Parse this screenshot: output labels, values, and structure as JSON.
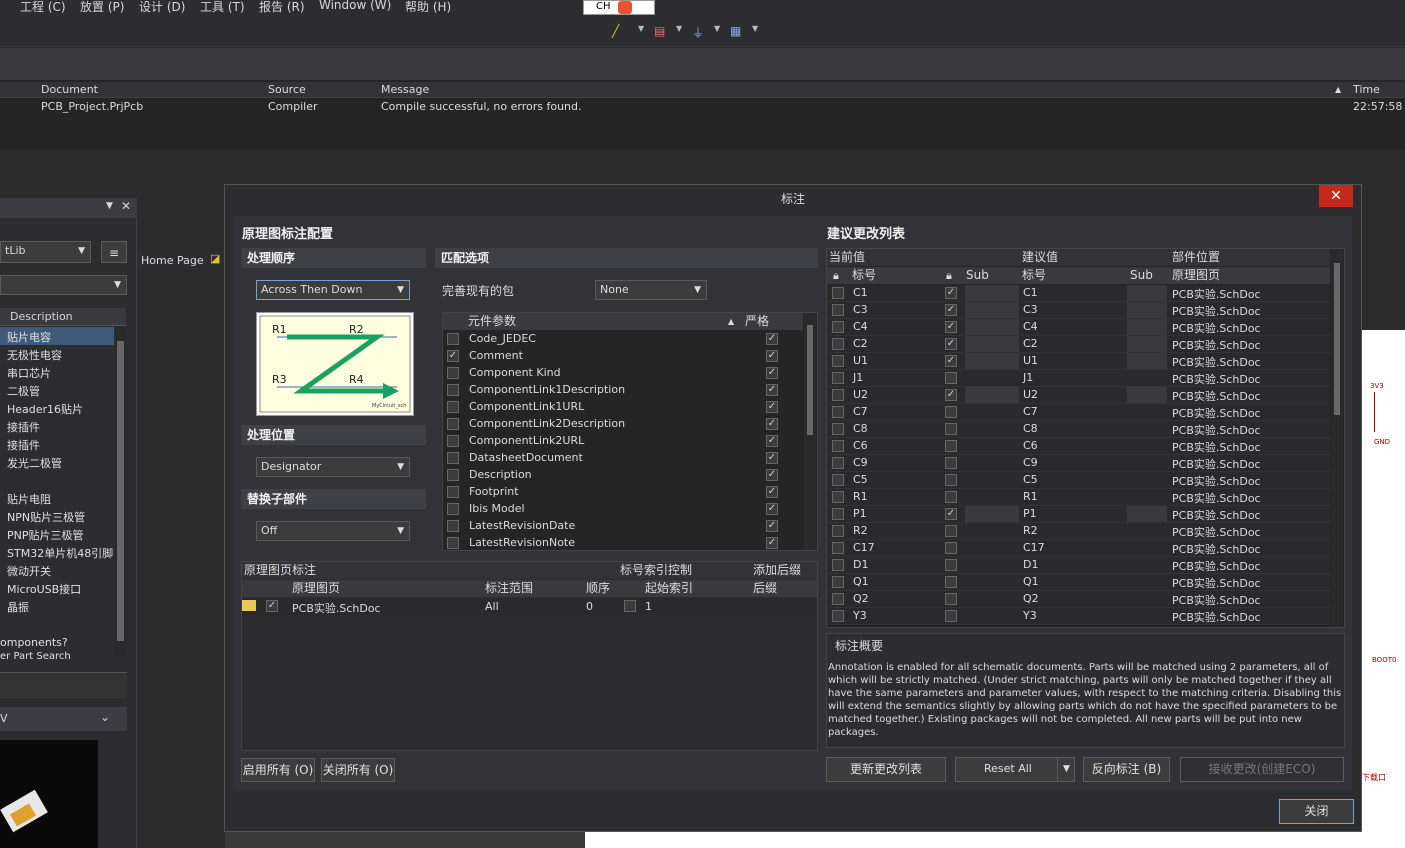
{
  "menu": [
    "工程 (C)",
    "放置 (P)",
    "设计 (D)",
    "工具 (T)",
    "报告 (R)",
    "Window (W)",
    "帮助 (H)"
  ],
  "ime_label": "CH",
  "messages": {
    "headers": {
      "document": "Document",
      "source": "Source",
      "message": "Message",
      "time": "Time"
    },
    "row": {
      "document": "PCB_Project.PrjPcb",
      "source": "Compiler",
      "message": "Compile successful, no errors found.",
      "time": "22:57:58"
    }
  },
  "left_panel": {
    "lib_combo": "tLib",
    "col_header": "Description",
    "items": [
      "贴片电容",
      "无极性电容",
      "串口芯片",
      "二极管",
      "Header16贴片",
      "接插件",
      "接插件",
      "发光二极管",
      "",
      "贴片电阻",
      "NPN贴片三极管",
      "PNP贴片三极管",
      "STM32单片机48引脚",
      "微动开关",
      "MicroUSB接口",
      "晶振"
    ],
    "footer1": "omponents?",
    "footer2": "er Part Search",
    "section2": "V"
  },
  "home_tab": "Home Page",
  "dialog": {
    "title": "标注",
    "close_glyph": "✕",
    "left_header": "原理图标注配置",
    "order_section": "处理顺序",
    "order_value": "Across Then Down",
    "location_section": "处理位置",
    "location_value": "Designator",
    "replace_section": "替换子部件",
    "replace_value": "Off",
    "diagram": {
      "r1": "R1",
      "r2": "R2",
      "r3": "R3",
      "r4": "R4",
      "caption": "MyCircuit_sch"
    },
    "match_section": "匹配选项",
    "complete_label": "完善现有的包",
    "complete_value": "None",
    "params_headers": {
      "param": "元件参数",
      "strict": "严格"
    },
    "params": [
      {
        "name": "Code_JEDEC",
        "checked": false
      },
      {
        "name": "Comment",
        "checked": true
      },
      {
        "name": "Component Kind",
        "checked": false
      },
      {
        "name": "ComponentLink1Description",
        "checked": false
      },
      {
        "name": "ComponentLink1URL",
        "checked": false
      },
      {
        "name": "ComponentLink2Description",
        "checked": false
      },
      {
        "name": "ComponentLink2URL",
        "checked": false
      },
      {
        "name": "DatasheetDocument",
        "checked": false
      },
      {
        "name": "Description",
        "checked": false
      },
      {
        "name": "Footprint",
        "checked": false
      },
      {
        "name": "Ibis Model",
        "checked": false
      },
      {
        "name": "LatestRevisionDate",
        "checked": false
      },
      {
        "name": "LatestRevisionNote",
        "checked": false
      }
    ],
    "sheet_table": {
      "headers_top": {
        "a": "原理图页标注",
        "b": "标号索引控制",
        "c": "添加后缀"
      },
      "headers": {
        "sheet": "原理图页",
        "scope": "标注范围",
        "order": "顺序",
        "start": "起始索引",
        "suffix": "后缀"
      },
      "row": {
        "sheet": "PCB实验.SchDoc",
        "scope": "All",
        "order": "0",
        "start": "1",
        "suffix": ""
      }
    },
    "enable_all": "启用所有 (O)",
    "disable_all": "关闭所有 (O)",
    "right_header": "建议更改列表",
    "proposed": {
      "group_current": "当前值",
      "group_proposed": "建议值",
      "group_location": "部件位置",
      "col_designator": "标号",
      "col_sub": "Sub",
      "col_designator2": "标号",
      "col_sub2": "Sub",
      "col_sheet": "原理图页",
      "rows": [
        {
          "cur": "C1",
          "lock": true,
          "prop": "C1",
          "sheet": "PCB实验.SchDoc"
        },
        {
          "cur": "C3",
          "lock": true,
          "prop": "C3",
          "sheet": "PCB实验.SchDoc"
        },
        {
          "cur": "C4",
          "lock": true,
          "prop": "C4",
          "sheet": "PCB实验.SchDoc"
        },
        {
          "cur": "C2",
          "lock": true,
          "prop": "C2",
          "sheet": "PCB实验.SchDoc"
        },
        {
          "cur": "U1",
          "lock": true,
          "prop": "U1",
          "sheet": "PCB实验.SchDoc"
        },
        {
          "cur": "J1",
          "lock": false,
          "prop": "J1",
          "sheet": "PCB实验.SchDoc"
        },
        {
          "cur": "U2",
          "lock": true,
          "prop": "U2",
          "sheet": "PCB实验.SchDoc"
        },
        {
          "cur": "C7",
          "lock": false,
          "prop": "C7",
          "sheet": "PCB实验.SchDoc"
        },
        {
          "cur": "C8",
          "lock": false,
          "prop": "C8",
          "sheet": "PCB实验.SchDoc"
        },
        {
          "cur": "C6",
          "lock": false,
          "prop": "C6",
          "sheet": "PCB实验.SchDoc"
        },
        {
          "cur": "C9",
          "lock": false,
          "prop": "C9",
          "sheet": "PCB实验.SchDoc"
        },
        {
          "cur": "C5",
          "lock": false,
          "prop": "C5",
          "sheet": "PCB实验.SchDoc"
        },
        {
          "cur": "R1",
          "lock": false,
          "prop": "R1",
          "sheet": "PCB实验.SchDoc"
        },
        {
          "cur": "P1",
          "lock": true,
          "prop": "P1",
          "sheet": "PCB实验.SchDoc"
        },
        {
          "cur": "R2",
          "lock": false,
          "prop": "R2",
          "sheet": "PCB实验.SchDoc"
        },
        {
          "cur": "C17",
          "lock": false,
          "prop": "C17",
          "sheet": "PCB实验.SchDoc"
        },
        {
          "cur": "D1",
          "lock": false,
          "prop": "D1",
          "sheet": "PCB实验.SchDoc"
        },
        {
          "cur": "Q1",
          "lock": false,
          "prop": "Q1",
          "sheet": "PCB实验.SchDoc"
        },
        {
          "cur": "Q2",
          "lock": false,
          "prop": "Q2",
          "sheet": "PCB实验.SchDoc"
        },
        {
          "cur": "Y3",
          "lock": false,
          "prop": "Y3",
          "sheet": "PCB实验.SchDoc"
        }
      ]
    },
    "summary_title": "标注概要",
    "summary_text": "Annotation is enabled for all schematic documents. Parts will be matched using 2 parameters, all of which will be strictly matched. (Under strict matching, parts will only be matched together if they all have the same parameters and parameter values, with respect to the matching criteria. Disabling this will extend the semantics slightly by allowing parts which do not have the specified parameters to be matched together.) Existing packages will not be completed. All new parts will be put into new packages.",
    "btn_update": "更新更改列表",
    "btn_reset": "Reset All",
    "btn_back": "反向标注 (B)",
    "btn_accept": "接收更改(创建ECO)",
    "btn_close": "关闭"
  }
}
